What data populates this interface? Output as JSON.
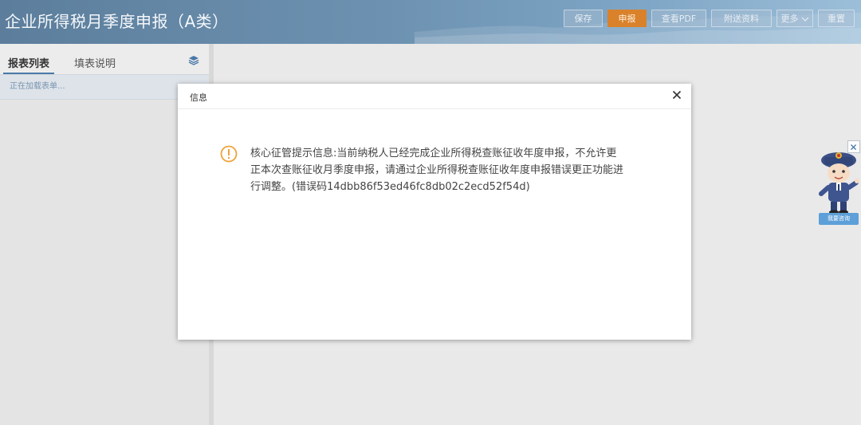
{
  "header": {
    "title": "企业所得税月季度申报（A类）",
    "buttons": {
      "save": "保存",
      "submit": "申报",
      "view_pdf": "查看PDF",
      "attach": "附送资料",
      "more": "更多",
      "reset": "重置"
    }
  },
  "sidebar": {
    "tabs": [
      "报表列表",
      "填表说明"
    ],
    "loading_text": "正在加载表单..."
  },
  "dialog": {
    "title": "信息",
    "message": "核心征管提示信息:当前纳税人已经完成企业所得税查账征收年度申报，不允许更\n正本次查账征收月季度申报，请通过企业所得税查账征收年度申报错误更正功能进\n行调整。(错误码14dbb86f53ed46fc8db02c2ecd52f54d)"
  },
  "assistant": {
    "button_label": "我要咨询"
  },
  "colors": {
    "header_bg": "#6d92b1",
    "primary_button": "#d9822b",
    "warning_icon": "#f0a23a",
    "assistant_button": "#5d9fd8"
  },
  "icons": [
    "layers-icon",
    "close-icon",
    "warning-icon",
    "assistant-mascot-icon"
  ]
}
